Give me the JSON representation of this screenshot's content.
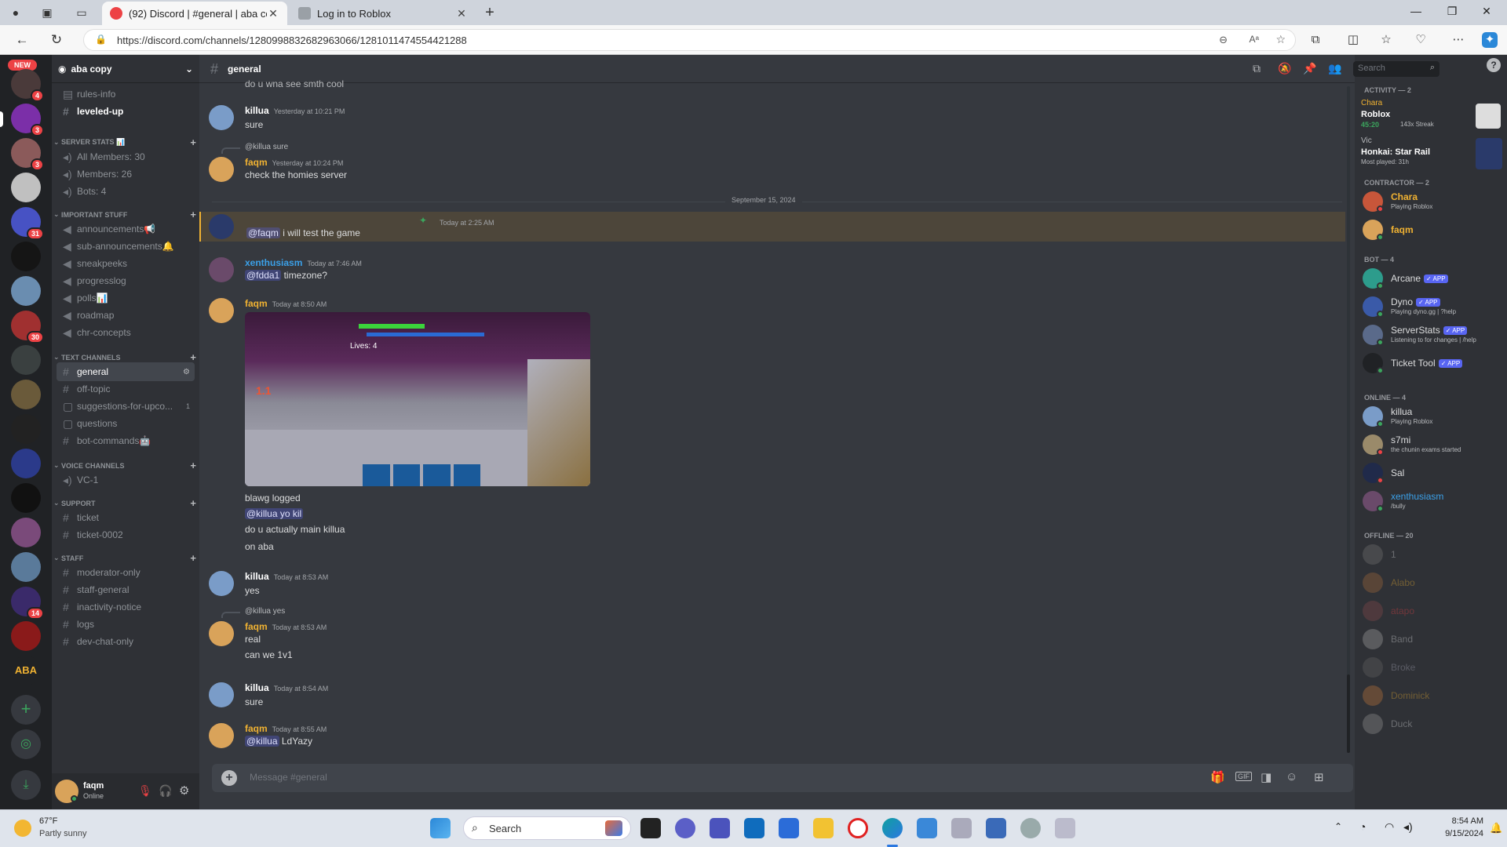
{
  "browser": {
    "tabs": [
      {
        "label": "(92) Discord | #general | aba copy",
        "active": true
      },
      {
        "label": "Log in to Roblox",
        "active": false
      }
    ],
    "url": "https://discord.com/channels/1280998832682963066/1281011474554421288"
  },
  "server": {
    "name": "aba copy",
    "new_badge": "NEW",
    "guild_badges": [
      "4",
      "3",
      "3",
      "31",
      "30",
      "14"
    ]
  },
  "channels": {
    "top": [
      "rules-info",
      "leveled-up"
    ],
    "categories": [
      {
        "name": "SERVER STATS 📊",
        "items": [
          "All Members: 30",
          "Members: 26",
          "Bots: 4"
        ]
      },
      {
        "name": "IMPORTANT STUFF",
        "items": [
          "announcements📢",
          "sub-announcements🔔",
          "sneakpeeks",
          "progresslog",
          "polls📊",
          "roadmap",
          "chr-concepts"
        ]
      },
      {
        "name": "TEXT CHANNELS",
        "items": [
          "general",
          "off-topic",
          "suggestions-for-upco...",
          "questions",
          "bot-commands🤖"
        ]
      },
      {
        "name": "VOICE CHANNELS",
        "items": [
          "VC-1"
        ]
      },
      {
        "name": "SUPPORT",
        "items": [
          "ticket",
          "ticket-0002"
        ]
      },
      {
        "name": "STAFF",
        "items": [
          "moderator-only",
          "staff-general",
          "inactivity-notice",
          "logs",
          "dev-chat-only"
        ]
      }
    ],
    "suggestions_count": "1"
  },
  "user_panel": {
    "name": "faqm",
    "status": "Online"
  },
  "chat": {
    "channel": "general",
    "search_placeholder": "Search",
    "composer_placeholder": "Message #general",
    "date_divider": "September 15, 2024",
    "partial_top": "do u wna see smth cool",
    "messages": [
      {
        "author": "killua",
        "ts": "Yesterday at 10:21 PM",
        "lines": [
          "sure"
        ]
      },
      {
        "reply": "@killua sure",
        "author": "faqm",
        "ts": "Yesterday at 10:24 PM",
        "lines": [
          "check the homies server"
        ]
      },
      {
        "author": "",
        "ts": "Today at 2:25 AM",
        "mention": "@faqm",
        "lines": [
          "i will test the game"
        ]
      },
      {
        "author": "xenthusiasm",
        "ts": "Today at 7:46 AM",
        "mention": "@fdda1",
        "lines": [
          "timezone?"
        ]
      },
      {
        "author": "faqm",
        "ts": "Today at 8:50 AM",
        "lines": [
          "blawg logged",
          "@killua yo kil",
          "do u actually main killua",
          "on aba"
        ]
      },
      {
        "author": "killua",
        "ts": "Today at 8:53 AM",
        "lines": [
          "yes"
        ]
      },
      {
        "reply": "@killua yes",
        "author": "faqm",
        "ts": "Today at 8:53 AM",
        "lines": [
          "real",
          "can we 1v1"
        ]
      },
      {
        "author": "killua",
        "ts": "Today at 8:54 AM",
        "lines": [
          "sure"
        ]
      },
      {
        "author": "faqm",
        "ts": "Today at 8:55 AM",
        "mention": "@killua",
        "lines": [
          "LdYazy"
        ]
      }
    ],
    "image_overlay": {
      "lives": "Lives: 4",
      "score": "1.1"
    }
  },
  "members": {
    "activity": {
      "title": "ACTIVITY — 2",
      "cards": [
        {
          "user": "Chara",
          "game": "Roblox",
          "time": "45:20",
          "streak": "143x Streak"
        },
        {
          "user": "Vic",
          "game": "Honkai: Star Rail",
          "stat": "Most played: 31h"
        }
      ]
    },
    "groups": [
      {
        "title": "CONTRACTOR — 2",
        "members": [
          {
            "name": "Chara",
            "sub": "Playing Roblox",
            "color": "#f0b232"
          },
          {
            "name": "faqm",
            "sub": "",
            "color": "#f0b232"
          }
        ]
      },
      {
        "title": "BOT — 4",
        "members": [
          {
            "name": "Arcane",
            "sub": "",
            "app": "✓ APP",
            "color": "#dcddde"
          },
          {
            "name": "Dyno",
            "sub": "Playing dyno.gg | ?help",
            "app": "✓ APP",
            "color": "#dcddde"
          },
          {
            "name": "ServerStats",
            "sub": "Listening to for changes | /help",
            "app": "✓ APP",
            "color": "#dcddde"
          },
          {
            "name": "Ticket Tool",
            "sub": "",
            "app": "✓ APP",
            "color": "#dcddde"
          }
        ]
      },
      {
        "title": "ONLINE — 4",
        "members": [
          {
            "name": "killua",
            "sub": "Playing Roblox",
            "color": "#dcddde"
          },
          {
            "name": "s7mi",
            "sub": "the chunin exams started",
            "color": "#dcddde"
          },
          {
            "name": "Sal",
            "sub": "",
            "color": "#dcddde"
          },
          {
            "name": "xenthusiasm",
            "sub": "/bully",
            "color": "#3ba0e8"
          }
        ]
      },
      {
        "title": "OFFLINE — 20",
        "members": [
          {
            "name": "1",
            "sub": "",
            "color": "#dcddde"
          },
          {
            "name": "Alabo",
            "sub": "",
            "color": "#f0b232"
          },
          {
            "name": "atapo",
            "sub": "",
            "color": "#ed4245"
          },
          {
            "name": "Band",
            "sub": "",
            "color": "#dcddde"
          },
          {
            "name": "Broke",
            "sub": "",
            "color": "#aab"
          },
          {
            "name": "Dominick",
            "sub": "",
            "color": "#f0b232"
          },
          {
            "name": "Duck",
            "sub": "",
            "color": "#dcddde"
          }
        ]
      }
    ]
  },
  "taskbar": {
    "weather_temp": "67°F",
    "weather_desc": "Partly sunny",
    "search": "Search",
    "time": "8:54 AM",
    "date": "9/15/2024"
  },
  "colors": {
    "accent": "#5865f2",
    "gold": "#f0b232",
    "online": "#3ba55d",
    "dnd": "#ed4245"
  }
}
